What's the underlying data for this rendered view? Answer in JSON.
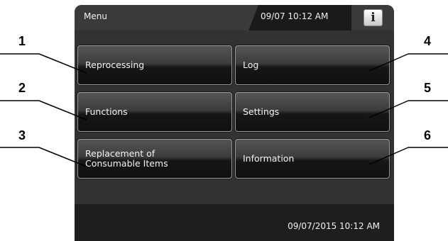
{
  "header": {
    "title": "Menu",
    "datetime": "09/07 10:12 AM",
    "info_button_glyph": "i"
  },
  "menu": {
    "buttons": [
      {
        "label": "Reprocessing",
        "callout": "1"
      },
      {
        "label": "Log",
        "callout": "4"
      },
      {
        "label": "Functions",
        "callout": "2"
      },
      {
        "label": "Settings",
        "callout": "5"
      },
      {
        "label": "Replacement of\nConsumable Items",
        "callout": "3"
      },
      {
        "label": "Information",
        "callout": "6"
      }
    ]
  },
  "footer": {
    "datetime": "09/07/2015 10:12 AM"
  },
  "icons": {
    "info_button": "info-icon"
  },
  "colors": {
    "screen_background": "#2b2b2b",
    "button_border": "#9a9a9a",
    "text": "#f4f4f4"
  }
}
